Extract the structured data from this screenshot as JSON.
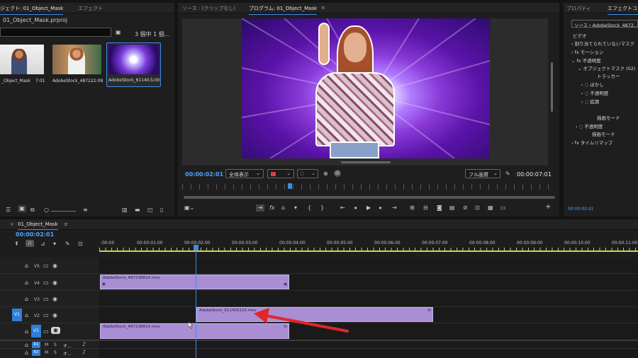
{
  "project": {
    "tab_project": "ジェクト: 01_Object_Mask",
    "tab_effect": "エフェクト",
    "file_name": "01_Object_Mask.prproj",
    "item_count": "3 個中 1 個...",
    "items": [
      {
        "name": "_Object_Mask",
        "duration": "7:01"
      },
      {
        "name": "AdobeStock_4872...",
        "duration": "22:08"
      },
      {
        "name": "AdobeStock_61140...",
        "duration": "5:00"
      }
    ]
  },
  "program": {
    "tab_source": "ソース : (クリップなし)",
    "tab_program": "プログラム: 01_Object_Mask",
    "timecode": "00:00:02:01",
    "fit": "全体表示",
    "quality": "フル画質",
    "duration": "00:00:07:01"
  },
  "effects": {
    "tab_props": "プロパティ",
    "tab_effects": "エフェクトコン",
    "source": "ソース・AdobeStock_4872...",
    "video": "ビデオ",
    "rows": [
      "割り当てられていないマスク",
      "fx モーション",
      "fx 不透明度",
      "オブジェクトマスク (02)",
      "トラッカー",
      "ぼかし",
      "不透明度",
      "拡張",
      "描画モード",
      "不透明度",
      "描画モード",
      "タイムリマップ"
    ],
    "timecode": "00:00:02:01"
  },
  "timeline": {
    "tab": "01_Object_Mask",
    "timecode": "00:00:02:01",
    "ruler": [
      ":00:00",
      "00:00:01:00",
      "00:00:02:00",
      "00:00:03:00",
      "00:00:04:00",
      "00:00:05:00",
      "00:00:06:00",
      "00:00:07:00",
      "00:00:08:00",
      "00:00:09:00",
      "00:00:10:00",
      "00:00:11:00"
    ],
    "tracks": [
      "V5",
      "V4",
      "V3",
      "V2",
      "V1",
      "A1",
      "A2",
      "A3"
    ],
    "src_v1": "V1",
    "clip_v4": "AdobeStock_487238814.mov",
    "clip_v2": "AdobeStock_611405223.mov",
    "clip_v1": "AdobeStock_487238814.mov",
    "audio_ms": "M",
    "audio_s": "S",
    "audio_o": "オ..."
  },
  "colors": {
    "accent": "#3d8ce6",
    "clip": "#a98ed4",
    "arrow": "#e0262b",
    "timecode": "#4da3ff"
  }
}
